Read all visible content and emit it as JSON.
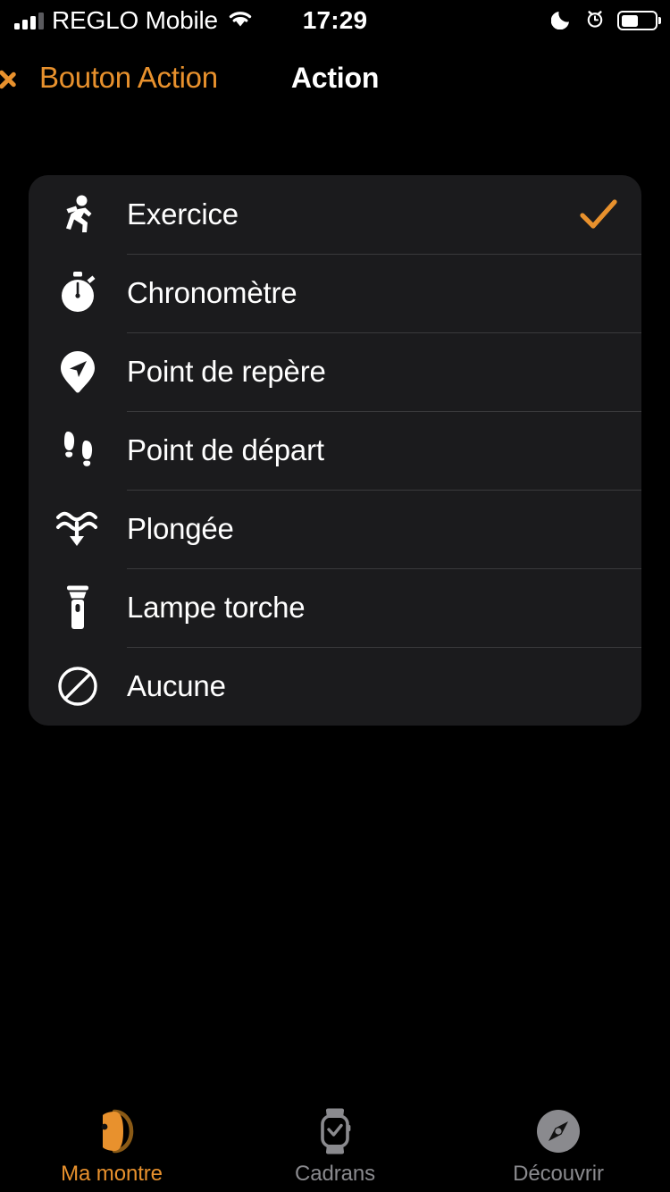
{
  "status_bar": {
    "carrier": "REGLO Mobile",
    "time": "17:29",
    "signal_icon": "cellular-bars-icon",
    "wifi_icon": "wifi-icon",
    "dnd_icon": "moon-icon",
    "alarm_icon": "alarm-clock-icon",
    "battery_icon": "battery-icon",
    "battery_level_percent": 50
  },
  "nav": {
    "back_label": "Bouton Action",
    "back_icon": "chevron-left-icon",
    "title": "Action",
    "accent_color": "#E8912D"
  },
  "options": {
    "selected": "Exercice",
    "check_icon": "checkmark-icon",
    "items": [
      {
        "label": "Exercice",
        "icon": "running-figure-icon",
        "selected": true
      },
      {
        "label": "Chronomètre",
        "icon": "stopwatch-icon",
        "selected": false
      },
      {
        "label": "Point de repère",
        "icon": "map-pin-arrow-icon",
        "selected": false
      },
      {
        "label": "Point de départ",
        "icon": "footprints-icon",
        "selected": false
      },
      {
        "label": "Plongée",
        "icon": "water-dive-icon",
        "selected": false
      },
      {
        "label": "Lampe torche",
        "icon": "flashlight-icon",
        "selected": false
      },
      {
        "label": "Aucune",
        "icon": "no-entry-slash-icon",
        "selected": false
      }
    ]
  },
  "tabbar": {
    "active_index": 0,
    "items": [
      {
        "label": "Ma montre",
        "icon": "watch-side-icon",
        "active": true
      },
      {
        "label": "Cadrans",
        "icon": "watch-face-check-icon",
        "active": false
      },
      {
        "label": "Découvrir",
        "icon": "compass-icon",
        "active": false
      }
    ],
    "active_color": "#E8912D",
    "inactive_color": "#8A8A8E"
  }
}
